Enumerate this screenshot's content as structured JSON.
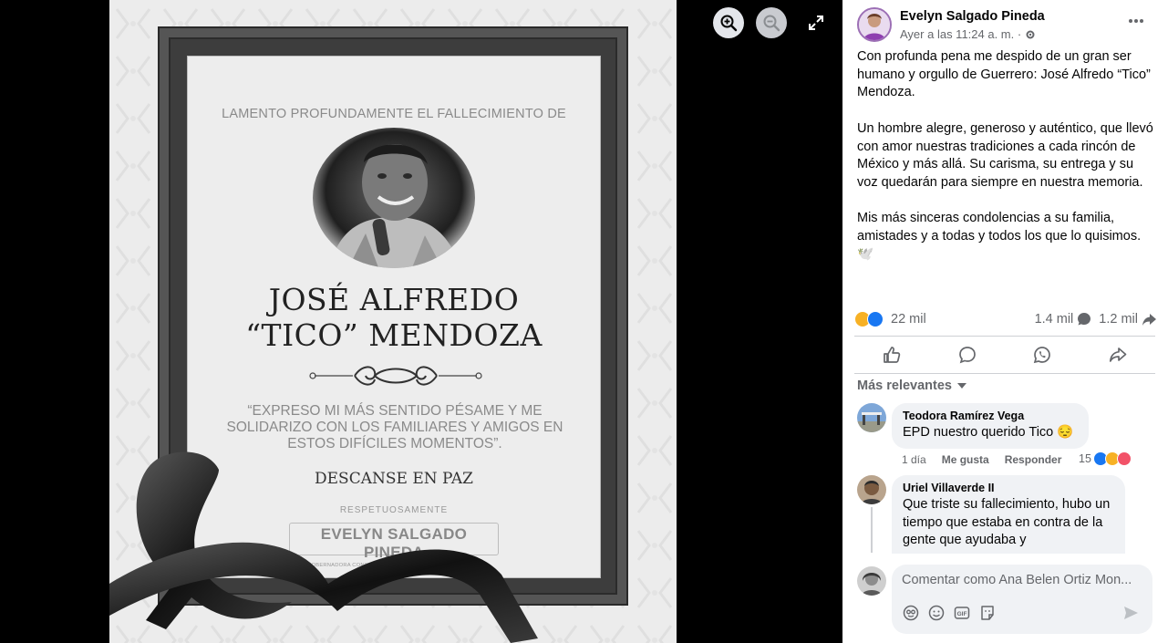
{
  "photo": {
    "lamento": "LAMENTO PROFUNDAMENTE EL FALLECIMIENTO DE",
    "name_line1": "JOSÉ  ALFREDO",
    "name_line2": "“TICO” MENDOZA",
    "quote": "“EXPRESO MI MÁS SENTIDO PÉSAME Y ME SOLIDARIZO CON LOS FAMILIARES Y AMIGOS EN ESTOS DIFÍCILES MOMENTOS”.",
    "descanse": "DESCANSE EN PAZ",
    "respetuosamente": "RESPETUOSAMENTE",
    "signature_name": "EVELYN SALGADO PINEDA",
    "signature_title": "GOBERNADORA CONSTITUCIONAL DEL ESTADO DE GUERRERO"
  },
  "viewer_controls": {
    "zoom_in_icon": "zoom-in-icon",
    "zoom_out_icon": "zoom-out-icon",
    "expand_icon": "expand-icon"
  },
  "post": {
    "author": "Evelyn Salgado Pineda",
    "time": "Ayer a las 11:24 a. m. ·",
    "paragraphs": [
      "Con profunda pena me despido de un gran ser humano y orgullo de Guerrero: José Alfredo “Tico” Mendoza.",
      "Un hombre alegre, generoso y auténtico, que llevó con amor nuestras tradiciones a cada rincón de México y más allá. Su carisma, su entrega y su voz quedarán para siempre en nuestra memoria.",
      "Mis más sinceras condolencias a su familia, amistades y a todas y todos los que lo quisimos.🕊️"
    ],
    "reactions_count": "22 mil",
    "comments_count": "1.4 mil",
    "shares_count": "1.2 mil"
  },
  "comments_header": "Más relevantes",
  "comments": [
    {
      "name": "Teodora Ramírez Vega",
      "text": "EPD nuestro querido Tico 😔",
      "age": "1 día",
      "like": "Me gusta",
      "reply": "Responder",
      "reactions": "15"
    },
    {
      "name": "Uriel Villaverde II",
      "text": "Que triste su fallecimiento, hubo un tiempo que estaba en contra de la gente que ayudaba y"
    }
  ],
  "composer": {
    "placeholder": "Comentar como Ana Belen Ortiz Mon..."
  },
  "colors": {
    "accent": "#1877f2",
    "secondary_text": "#65676b",
    "bubble_bg": "#f0f2f5"
  }
}
